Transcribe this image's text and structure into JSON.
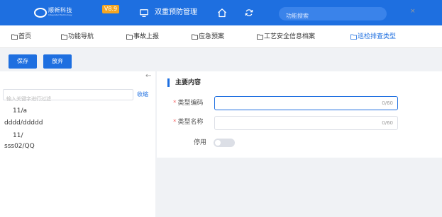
{
  "header": {
    "logo": {
      "name": "顺新科技",
      "tagline": "Integrated Technology"
    },
    "version": "V8.9",
    "title": "双重预防管理",
    "search_placeholder": "功能搜索",
    "icons": [
      "monitor-icon",
      "home-icon",
      "refresh-icon"
    ],
    "color": "#1e6fe0"
  },
  "tabs": [
    {
      "label": "首页"
    },
    {
      "label": "功能导航"
    },
    {
      "label": "事故上报"
    },
    {
      "label": "应急预案"
    },
    {
      "label": "工艺安全信息档案"
    },
    {
      "label": "巡检排查类型",
      "active": true
    }
  ],
  "tab_close": "×",
  "toolbar": {
    "save_label": "保存",
    "discard_label": "放弃"
  },
  "left_panel": {
    "collapse_arrow": "←",
    "filter_placeholder": "输入关键字进行过滤",
    "collapse_label": "收缩",
    "tree_items": [
      "11/a",
      "dddd/ddddd",
      "11/",
      "sss02/QQ"
    ]
  },
  "form": {
    "section_title": "主要内容",
    "type_code": {
      "label": "类型编码",
      "value": "",
      "counter": "0/60",
      "required": true
    },
    "type_name": {
      "label": "类型名称",
      "value": "",
      "counter": "0/60",
      "required": true
    },
    "disable": {
      "label": "停用",
      "checked": false
    }
  },
  "colors": {
    "accent": "#1e6fe0",
    "version_badge": "#f5a623",
    "required": "#f56c6c"
  }
}
